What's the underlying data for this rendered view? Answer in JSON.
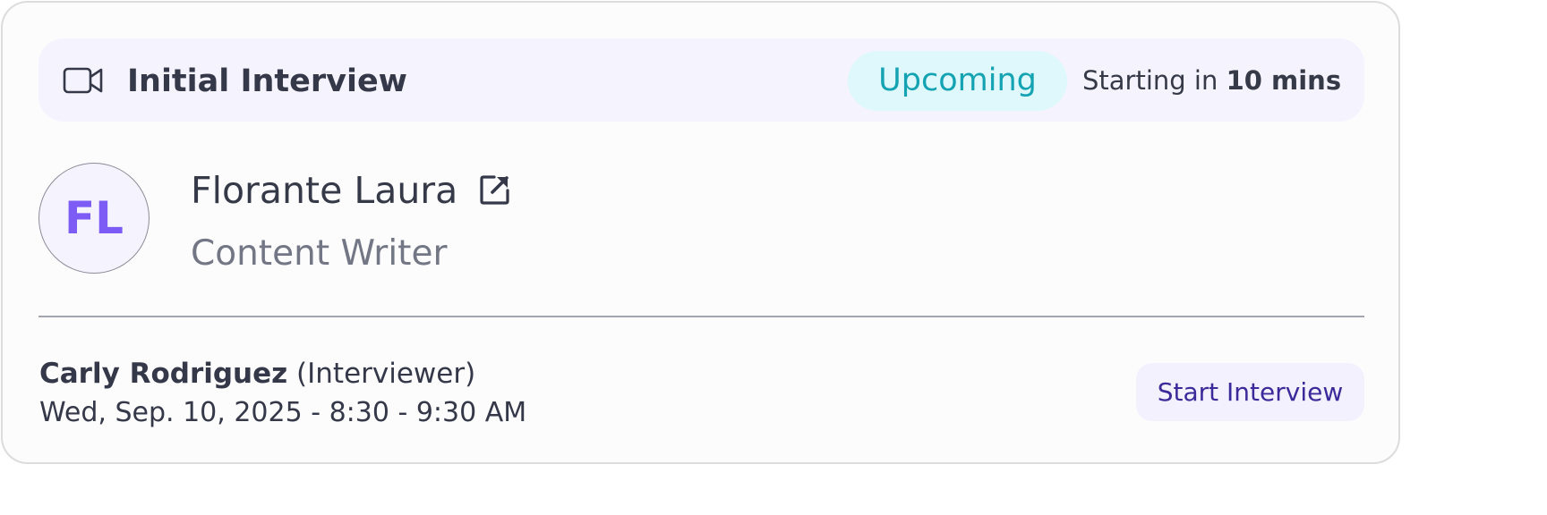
{
  "interview": {
    "title": "Initial Interview",
    "status": "Upcoming",
    "starting_prefix": "Starting in",
    "starting_time": "10 mins"
  },
  "candidate": {
    "initials": "FL",
    "name": "Florante Laura",
    "role": "Content Writer"
  },
  "schedule": {
    "interviewer_name": "Carly Rodriguez",
    "interviewer_role": "(Interviewer)",
    "datetime": "Wed, Sep. 10, 2025 - 8:30 - 9:30 AM"
  },
  "actions": {
    "start_label": "Start Interview"
  },
  "icons": {
    "meeting": "video-camera-icon",
    "profile_link": "external-link-icon"
  },
  "colors": {
    "header_bg": "#f5f3fe",
    "badge_bg": "#def8fc",
    "badge_text": "#14a3b3",
    "avatar_text": "#7c5cf4",
    "button_text": "#3b2a9a"
  }
}
